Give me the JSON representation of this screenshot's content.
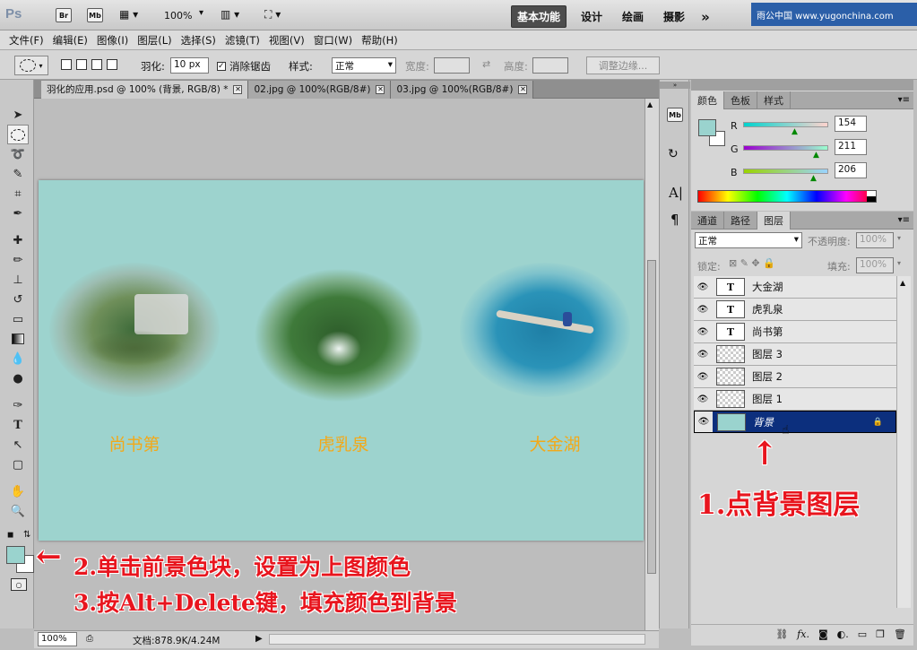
{
  "app": {
    "logo": "Ps",
    "br": "Br",
    "mb": "Mb",
    "zoom": "100%"
  },
  "workspaces": [
    "基本功能",
    "设计",
    "绘画",
    "摄影"
  ],
  "more_label": "»",
  "watermark": "雨公中国 www.yugonchina.com",
  "menu": [
    "文件(F)",
    "编辑(E)",
    "图像(I)",
    "图层(L)",
    "选择(S)",
    "滤镜(T)",
    "视图(V)",
    "窗口(W)",
    "帮助(H)"
  ],
  "options": {
    "feather_label": "羽化:",
    "feather_value": "10 px",
    "antialias_label": "消除锯齿",
    "style_label": "样式:",
    "style_value": "正常",
    "width_label": "宽度:",
    "height_label": "高度:",
    "refine_label": "调整边缘..."
  },
  "tabs": [
    {
      "label": "羽化的应用.psd @ 100% (背景, RGB/8) *",
      "active": true
    },
    {
      "label": "02.jpg @ 100%(RGB/8#)",
      "active": false
    },
    {
      "label": "03.jpg @ 100%(RGB/8#)",
      "active": false
    }
  ],
  "captions": [
    "尚书第",
    "虎乳泉",
    "大金湖"
  ],
  "status": {
    "zoom": "100%",
    "doc_label": "文档:878.9K/4.24M"
  },
  "color_panel": {
    "tabs": [
      "颜色",
      "色板",
      "样式"
    ],
    "r_label": "R",
    "g_label": "G",
    "b_label": "B",
    "r": "154",
    "g": "211",
    "b": "206",
    "fg_color": "#9ad3ce"
  },
  "layers_panel": {
    "tabs": [
      "通道",
      "路径",
      "图层"
    ],
    "blend": "正常",
    "opacity_label": "不透明度:",
    "opacity": "100%",
    "lock_label": "锁定:",
    "fill_label": "填充:",
    "fill": "100%"
  },
  "layers": [
    {
      "name": "大金湖",
      "kind": "text",
      "thumb": "T"
    },
    {
      "name": "虎乳泉",
      "kind": "text",
      "thumb": "T"
    },
    {
      "name": "尚书第",
      "kind": "text",
      "thumb": "T"
    },
    {
      "name": "图层 3",
      "kind": "image",
      "thumb": ""
    },
    {
      "name": "图层 2",
      "kind": "image",
      "thumb": ""
    },
    {
      "name": "图层 1",
      "kind": "image",
      "thumb": ""
    },
    {
      "name": "背景",
      "kind": "background",
      "thumb": ""
    }
  ],
  "annotations": {
    "step1": "1.点背景图层",
    "step2": "2.单击前景色块，设置为上图颜色",
    "step3": "3.按Alt+Delete键，填充颜色到背景",
    "arrow_up": "↑",
    "arrow_left": "←"
  }
}
